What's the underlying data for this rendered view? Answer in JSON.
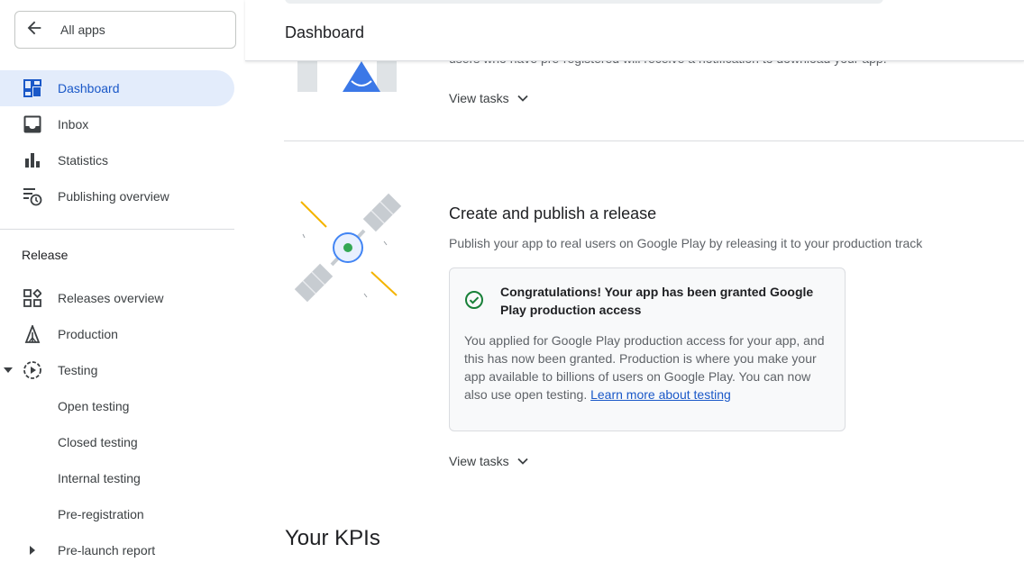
{
  "sidebar": {
    "all_apps": "All apps",
    "items": [
      {
        "label": "Dashboard",
        "icon": "dashboard-icon",
        "active": true
      },
      {
        "label": "Inbox",
        "icon": "inbox-icon"
      },
      {
        "label": "Statistics",
        "icon": "bar-chart-icon"
      },
      {
        "label": "Publishing overview",
        "icon": "publishing-icon"
      }
    ],
    "section_release": "Release",
    "release_items": [
      {
        "label": "Releases overview",
        "icon": "releases-overview-icon"
      },
      {
        "label": "Production",
        "icon": "production-icon"
      },
      {
        "label": "Testing",
        "icon": "testing-icon"
      },
      {
        "label": "Open testing"
      },
      {
        "label": "Closed testing"
      },
      {
        "label": "Internal testing"
      },
      {
        "label": "Pre-registration"
      },
      {
        "label": "Pre-launch report"
      }
    ]
  },
  "header": {
    "title": "Dashboard"
  },
  "main": {
    "cutoff_text": "users who have pre-registered will receive a notification to download your app.",
    "view_tasks_1": "View tasks",
    "release_card": {
      "title": "Create and publish a release",
      "subtitle": "Publish your app to real users on Google Play by releasing it to your production track",
      "notice_title": "Congratulations! Your app has been granted Google Play production access",
      "notice_body": "You applied for Google Play production access for your app, and this has now been granted. Production is where you make your app available to billions of users on Google Play. You can now also use open testing.",
      "notice_link": "Learn more about testing",
      "view_tasks": "View tasks"
    },
    "kpis_title": "Your KPIs"
  },
  "colors": {
    "accent": "#1a58c8",
    "active_bg": "#e3ecfb",
    "success": "#188038"
  }
}
